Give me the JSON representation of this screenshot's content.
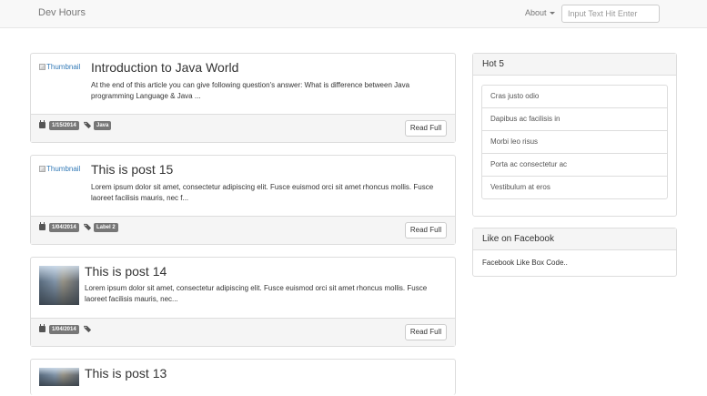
{
  "navbar": {
    "brand": "Dev Hours",
    "about_label": "About",
    "search_placeholder": "Input Text Hit Enter"
  },
  "posts": [
    {
      "thumbnail_alt": "Thumbnail",
      "title": "Introduction to Java World",
      "summary": "At the end of this article you can give following question's answer: What is difference between Java programming Language & Java ...",
      "date": "1/15/2014",
      "label": "Java",
      "read_label": "Read Full"
    },
    {
      "thumbnail_alt": "Thumbnail",
      "title": "This is post 15",
      "summary": "Lorem ipsum dolor sit amet, consectetur adipiscing elit. Fusce euismod orci sit amet rhoncus mollis. Fusce laoreet facilisis mauris, nec f...",
      "date": "1/04/2014",
      "label": "Label 2",
      "read_label": "Read Full"
    },
    {
      "title": "This is post 14",
      "summary": "Lorem ipsum dolor sit amet, consectetur adipiscing elit. Fusce euismod orci sit amet rhoncus mollis. Fusce laoreet facilisis mauris, nec...",
      "date": "1/04/2014",
      "read_label": "Read Full"
    },
    {
      "title": "This is post 13"
    }
  ],
  "sidebar": {
    "hot": {
      "heading": "Hot 5",
      "items": [
        "Cras justo odio",
        "Dapibus ac facilisis in",
        "Morbi leo risus",
        "Porta ac consectetur ac",
        "Vestibulum at eros"
      ]
    },
    "facebook": {
      "heading": "Like on Facebook",
      "body": "Facebook Like Box Code.."
    }
  }
}
